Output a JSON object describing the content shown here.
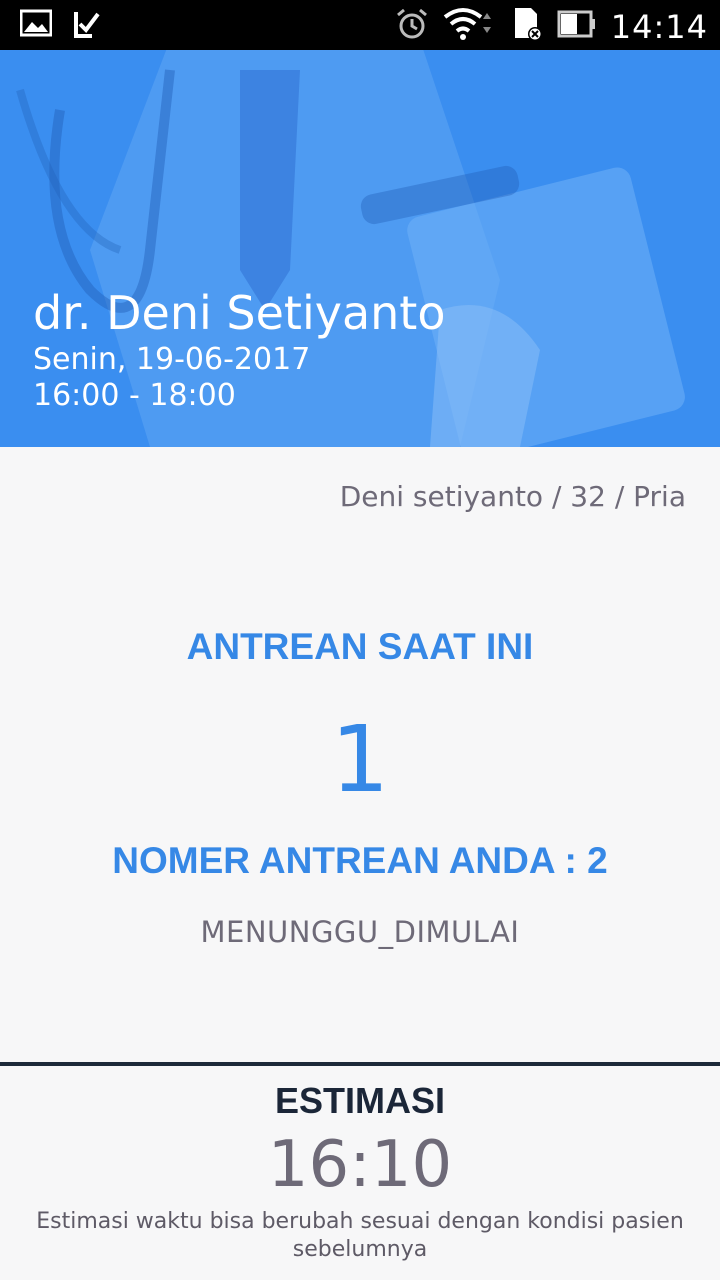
{
  "status_bar": {
    "time": "14:14",
    "icons": [
      "image-notification-icon",
      "task-check-icon",
      "alarm-icon",
      "wifi-icon",
      "sd-card-icon",
      "battery-icon"
    ]
  },
  "header": {
    "doctor_name": "dr. Deni Setiyanto",
    "date": "Senin, 19-06-2017",
    "time_range": "16:00 - 18:00",
    "accent_color": "#3a8ef0"
  },
  "patient_info": "Deni setiyanto / 32 / Pria",
  "queue": {
    "current_label": "ANTREAN SAAT INI",
    "current_number": "1",
    "your_number_label": "NOMER ANTREAN ANDA : 2",
    "status": "MENUNGGU_DIMULAI"
  },
  "estimation": {
    "label": "ESTIMASI",
    "time": "16:10",
    "note": "Estimasi waktu bisa berubah sesuai dengan kondisi pasien sebelumnya"
  }
}
